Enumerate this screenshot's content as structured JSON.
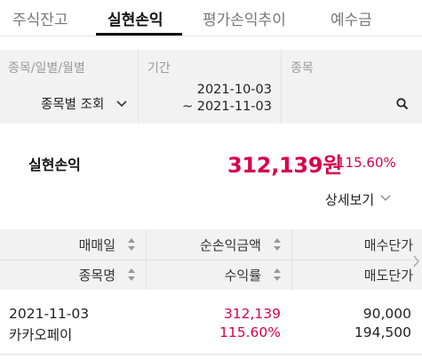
{
  "tabs": [
    {
      "label": "주식잔고"
    },
    {
      "label": "실현손익"
    },
    {
      "label": "평가손익추이"
    },
    {
      "label": "예수금"
    }
  ],
  "filter": {
    "type_label": "종목/일별/월별",
    "type_value": "종목별 조회",
    "period_label": "기간",
    "period_start": "2021-10-03",
    "period_end": "~ 2021-11-03",
    "stock_label": "종목"
  },
  "summary": {
    "label": "실현손익",
    "amount": "312,139원",
    "rate": "115.60%",
    "detail_label": "상세보기"
  },
  "table": {
    "headers_row1": [
      "매매일",
      "순손익금액",
      "매수단가"
    ],
    "headers_row2": [
      "종목명",
      "수익률",
      "매도단가"
    ],
    "rows": [
      {
        "date": "2021-11-03",
        "name": "카카오페이",
        "net_profit": "312,139",
        "rate": "115.60%",
        "buy_price": "90,000",
        "sell_price": "194,500"
      }
    ]
  },
  "colors": {
    "accent_red": "#d6004f",
    "header_bg": "#f2f2f2"
  },
  "icons": [
    "chevron-down-icon",
    "search-icon",
    "sort-icon",
    "chevron-right-icon"
  ]
}
